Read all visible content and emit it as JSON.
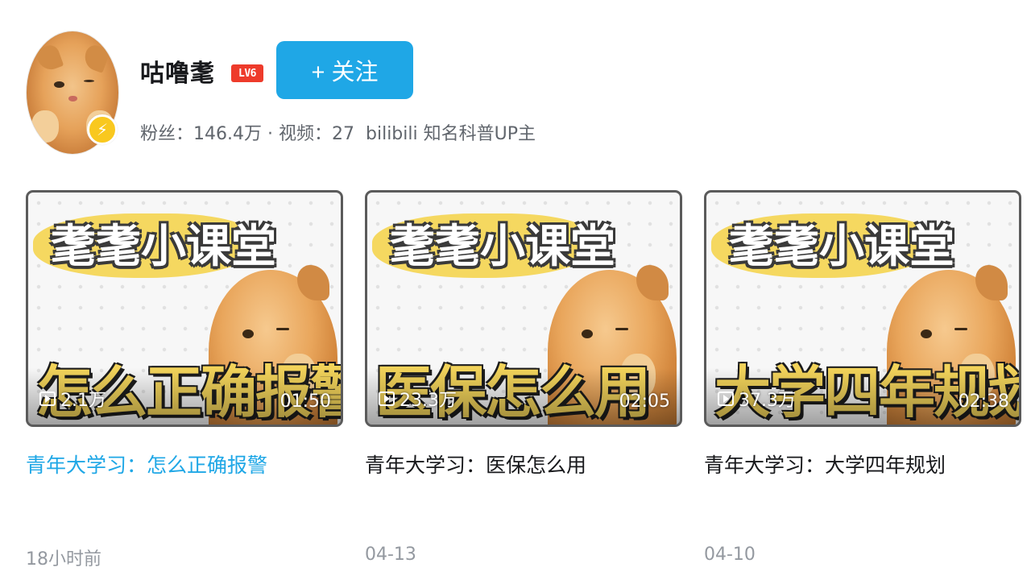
{
  "user": {
    "name": "咕噜耄",
    "level": "LV6",
    "follow_label": "+ 关注",
    "fans_label": "粉丝：",
    "fans": "146.4万",
    "sep": " · ",
    "videos_label": "视频：",
    "videos": "27",
    "badge_text": "bilibili 知名科普UP主",
    "verify_icon": "lightning-icon"
  },
  "colors": {
    "accent": "#1fa7e6",
    "level_bg": "#ee3b2b",
    "verify_badge": "#f9c81f",
    "thumb_banner": "#f5d860",
    "thumb_topic": "#f2d35a"
  },
  "videos": [
    {
      "thumb_series": "耄耄小课堂",
      "thumb_topic": "怎么正确报警",
      "views": "2.1万",
      "duration": "01:50",
      "title": "青年大学习：怎么正确报警",
      "date": "18小时前"
    },
    {
      "thumb_series": "耄耄小课堂",
      "thumb_topic": "医保怎么用",
      "views": "23.3万",
      "duration": "02:05",
      "title": "青年大学习：医保怎么用",
      "date": "04-13"
    },
    {
      "thumb_series": "耄耄小课堂",
      "thumb_topic": "大学四年规划",
      "views": "37.3万",
      "duration": "02:38",
      "title": "青年大学习：大学四年规划",
      "date": "04-10"
    }
  ]
}
